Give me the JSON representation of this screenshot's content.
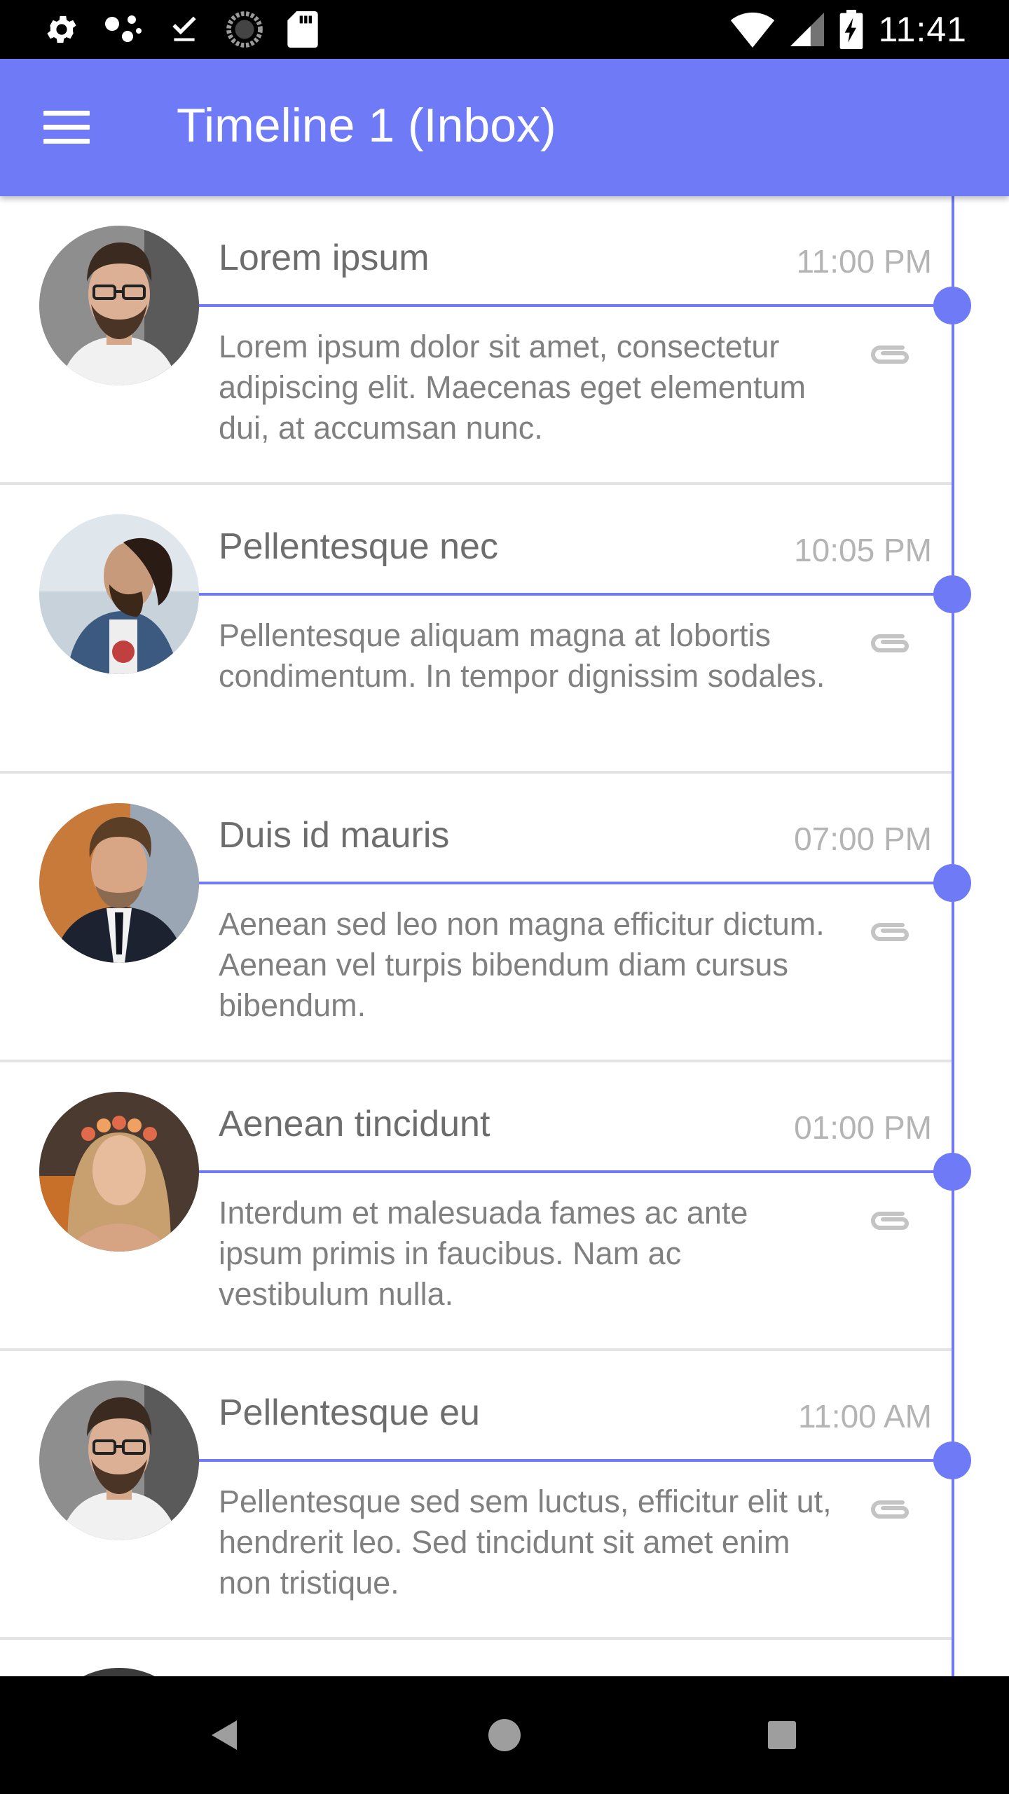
{
  "status_bar": {
    "time": "11:41",
    "left_icons": [
      "settings-icon",
      "nearby-icon",
      "download-done-icon",
      "sync-icon",
      "sd-card-icon"
    ],
    "right_icons": [
      "wifi-icon",
      "signal-icon",
      "battery-charging-icon"
    ]
  },
  "app_bar": {
    "title": "Timeline 1 (Inbox)",
    "menu_icon": "hamburger-menu-icon",
    "color": "#6f7af6"
  },
  "timeline": {
    "accent": "#6f7af6",
    "items": [
      {
        "title": "Lorem ipsum",
        "time": "11:00 PM",
        "body": "Lorem ipsum dolor sit amet, consectetur adipiscing elit. Maecenas eget elementum dui, at accumsan nunc.",
        "avatar": "man-glasses-avatar",
        "attachment_icon": "paperclip-icon"
      },
      {
        "title": "Pellentesque nec",
        "time": "10:05 PM",
        "body": "Pellentesque aliquam magna at lobortis condimentum. In tempor dignissim sodales.",
        "avatar": "bearded-man-profile-avatar",
        "attachment_icon": "paperclip-icon"
      },
      {
        "title": "Duis id mauris",
        "time": "07:00 PM",
        "body": "Aenean sed leo non magna efficitur dictum. Aenean vel turpis bibendum diam cursus bibendum.",
        "avatar": "man-suit-avatar",
        "attachment_icon": "paperclip-icon"
      },
      {
        "title": "Aenean tincidunt",
        "time": "01:00 PM",
        "body": "Interdum et malesuada fames ac ante ipsum primis in faucibus. Nam ac vestibulum nulla.",
        "avatar": "woman-flower-crown-avatar",
        "attachment_icon": "paperclip-icon"
      },
      {
        "title": "Pellentesque eu",
        "time": "11:00 AM",
        "body": "Pellentesque sed sem luctus, efficitur elit ut, hendrerit leo. Sed tincidunt sit amet enim non tristique.",
        "avatar": "man-glasses-avatar",
        "attachment_icon": "paperclip-icon"
      }
    ]
  },
  "nav_bar": {
    "icons": [
      "back-icon",
      "home-icon",
      "recents-icon"
    ]
  }
}
